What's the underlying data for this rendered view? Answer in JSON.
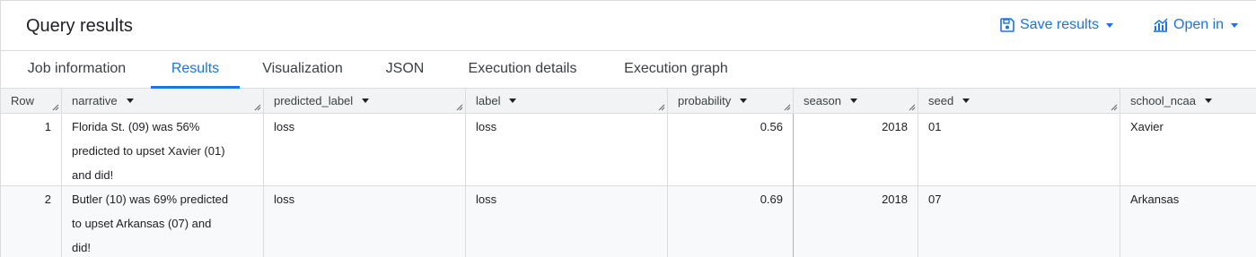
{
  "header": {
    "title": "Query results",
    "save_label": "Save results",
    "open_label": "Open in"
  },
  "tabs": [
    {
      "label": "Job information",
      "active": false
    },
    {
      "label": "Results",
      "active": true
    },
    {
      "label": "Visualization",
      "active": false
    },
    {
      "label": "JSON",
      "active": false
    },
    {
      "label": "Execution details",
      "active": false
    },
    {
      "label": "Execution graph",
      "active": false
    }
  ],
  "table": {
    "columns": [
      "Row",
      "narrative",
      "predicted_label",
      "label",
      "probability",
      "season",
      "seed",
      "school_ncaa"
    ],
    "rows": [
      {
        "row": "1",
        "narrative_lines": [
          "Florida St. (09) was 56%",
          "predicted to upset Xavier (01)",
          "and did!"
        ],
        "predicted_label": "loss",
        "label": "loss",
        "probability": "0.56",
        "season": "2018",
        "seed": "01",
        "school_ncaa": "Xavier"
      },
      {
        "row": "2",
        "narrative_lines": [
          "Butler (10) was 69% predicted",
          "to upset Arkansas (07) and",
          "did!"
        ],
        "predicted_label": "loss",
        "label": "loss",
        "probability": "0.69",
        "season": "2018",
        "seed": "07",
        "school_ncaa": "Arkansas"
      }
    ]
  },
  "colors": {
    "accent": "#1a73e8",
    "header_bg": "#f1f3f4",
    "border": "#dadce0"
  }
}
